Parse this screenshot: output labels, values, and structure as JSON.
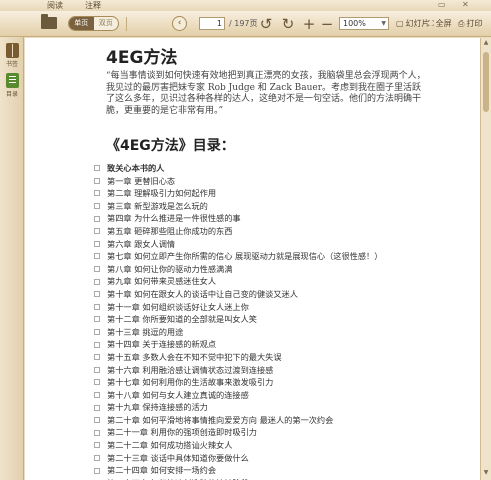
{
  "menu": {
    "items": [
      "阅读",
      "注释"
    ],
    "window_buttons": [
      "▭",
      "✕"
    ]
  },
  "toolbar": {
    "view_modes": [
      "单页",
      "双页"
    ],
    "page_current": "1",
    "page_total": "/ 197页",
    "zoom": "100%",
    "slideshow": "幻灯片",
    "fullscreen": "全屏",
    "print": "打印",
    "icons": [
      "folder-icon",
      "prev-page-icon",
      "next-page-icon",
      "rotate-left-icon",
      "rotate-right-icon",
      "zoom-in-icon",
      "zoom-out-icon",
      "slideshow-icon",
      "fullscreen-icon",
      "print-icon"
    ]
  },
  "sidebar": {
    "items": [
      {
        "label": "书签",
        "icon": "bookmark-icon"
      },
      {
        "label": "目录",
        "icon": "toc-icon"
      }
    ]
  },
  "document": {
    "title": "4EG方法",
    "quote": "“每当事情谈到如何快速有效地把到真正漂亮的女孩，我脑袋里总会浮现两个人，我见过的最厉害把妹专家 Rob Judge 和 Zack Bauer。考虑到我在圈子里活跃了这么多年，见识过各种各样的达人，这绝对不是一句空话。他们的方法明确干脆，更重要的是它非常有用。”",
    "toc_title": "《4EG方法》目录：",
    "toc": [
      "致关心本书的人",
      "第一章 更替旧心态",
      "第二章 理解吸引力如何起作用",
      "第三章 新型游戏是怎么玩的",
      "第四章 为什么推进是一件很性感的事",
      "第五章 砸碎那些阻止你成功的东西",
      "第六章 跟女人调情",
      "第七章 如何立即产生你所需的信心 展现驱动力就是展现信心（这很性感！）",
      "第八章 如何让你的驱动力性感满满",
      "第九章 如何带来灵感迷住女人",
      "第十章 如何在跟女人的谈话中让自己变的健谈又迷人",
      "第十一章 如何组织谈话好让女人迷上你",
      "第十二章 你所要知道的全部就是叫女人笑",
      "第十三章 挑逗的用途",
      "第十四章 关于连接感的新观点",
      "第十五章 多数人会在不知不觉中犯下的最大失误",
      "第十六章 利用融洽感让调情状态过渡到连接感",
      "第十七章 如何利用你的生活故事来激发吸引力",
      "第十八章 如何与女人建立真诚的连接感",
      "第十九章 保持连接感的活力",
      "第二十章 如何平滑地将事情推向爱爱方向 最迷人的第一次约会",
      "第二十一章 利用你的强项创造即时吸引力",
      "第二十二章 如何成功搭讪火辣女人",
      "第二十三章 谈话中具体知道你要做什么",
      "第二十四章 如何安排一场约会",
      "第二十五章 如何快速创造肢体接触阶段"
    ]
  }
}
